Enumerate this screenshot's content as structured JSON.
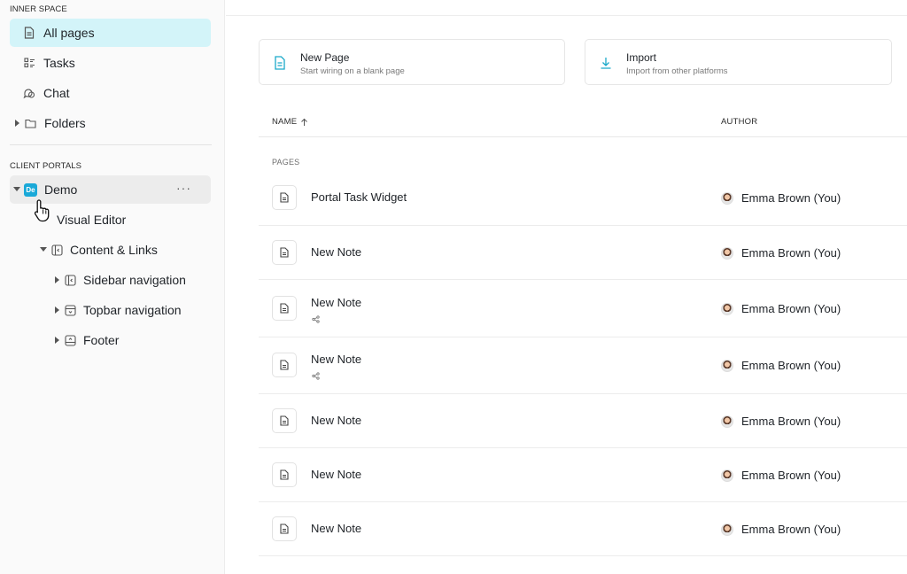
{
  "sidebar": {
    "inner_space_label": "INNER SPACE",
    "inner_items": [
      {
        "label": "All pages",
        "icon": "document-icon",
        "active": true
      },
      {
        "label": "Tasks",
        "icon": "tasks-icon"
      },
      {
        "label": "Chat",
        "icon": "chat-icon"
      },
      {
        "label": "Folders",
        "icon": "folder-icon"
      }
    ],
    "client_portals_label": "CLIENT PORTALS",
    "portal": {
      "badge": "De",
      "label": "Demo",
      "more": "···"
    },
    "portal_items": [
      {
        "label": "Visual Editor"
      },
      {
        "label": "Content & Links"
      },
      {
        "label": "Sidebar navigation"
      },
      {
        "label": "Topbar navigation"
      },
      {
        "label": "Footer"
      }
    ]
  },
  "actions": [
    {
      "title": "New Page",
      "subtitle": "Start wiring on a blank page",
      "icon": "new-page-icon"
    },
    {
      "title": "Import",
      "subtitle": "Import from other platforms",
      "icon": "download-icon"
    }
  ],
  "table": {
    "headers": {
      "name": "NAME",
      "author": "AUTHOR"
    },
    "group_label": "PAGES",
    "rows": [
      {
        "title": "Portal Task Widget",
        "author": "Emma Brown (You)",
        "shared": false
      },
      {
        "title": "New Note",
        "author": "Emma Brown (You)",
        "shared": false
      },
      {
        "title": "New Note",
        "author": "Emma Brown (You)",
        "shared": true
      },
      {
        "title": "New Note",
        "author": "Emma Brown (You)",
        "shared": true
      },
      {
        "title": "New Note",
        "author": "Emma Brown (You)",
        "shared": false
      },
      {
        "title": "New Note",
        "author": "Emma Brown (You)",
        "shared": false
      },
      {
        "title": "New Note",
        "author": "Emma Brown (You)",
        "shared": false
      }
    ]
  },
  "colors": {
    "accent": "#1aa9c9",
    "active_bg": "#d3f4f9",
    "badge": "#1aa9d8"
  }
}
